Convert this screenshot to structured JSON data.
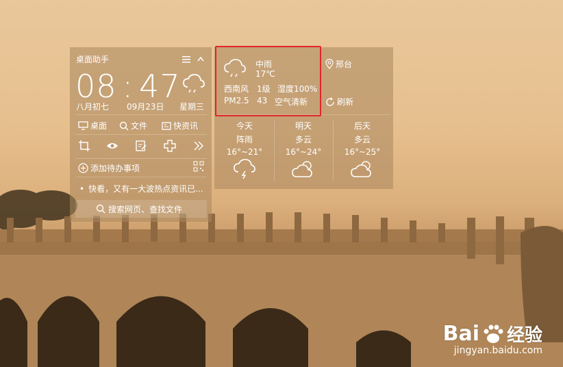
{
  "assistant": {
    "title": "桌面助手",
    "time_hours": "08",
    "time_sep": ":",
    "time_minutes": "47",
    "lunar_date": "八月初七",
    "date": "09月23日",
    "weekday": "星期三",
    "quick_links": [
      {
        "label": "桌面",
        "icon": "monitor-icon"
      },
      {
        "label": "文件",
        "icon": "search-icon"
      },
      {
        "label": "快资讯",
        "icon": "news-icon"
      }
    ],
    "tools": [
      "crop-icon",
      "eye-icon",
      "edit-icon",
      "puzzle-icon",
      "double-chevron-right-icon"
    ],
    "add_todo": "添加待办事项",
    "news_ticker": "快看，又有一大波热点资讯已...",
    "search_placeholder": "搜索网页、查找文件"
  },
  "weather": {
    "current": {
      "condition": "中雨",
      "temperature": "17℃",
      "wind": "西南风",
      "wind_level": "1级",
      "humidity": "湿度100%",
      "pm_label": "PM2.5",
      "pm_value": "43",
      "air_quality": "空气清新"
    },
    "location": "邢台",
    "refresh_label": "刷新",
    "forecast": [
      {
        "day": "今天",
        "condition": "阵雨",
        "range": "16°~21°",
        "icon": "thunder-rain-icon"
      },
      {
        "day": "明天",
        "condition": "多云",
        "range": "16°~24°",
        "icon": "cloudy-icon"
      },
      {
        "day": "后天",
        "condition": "多云",
        "range": "16°~25°",
        "icon": "cloudy-icon"
      }
    ]
  },
  "watermark": {
    "brand": "Bai",
    "brand2": "经验",
    "url": "jingyan.baidu.com"
  },
  "colors": {
    "highlight": "#e0262b",
    "panel": "rgba(170,135,95,0.55)"
  }
}
